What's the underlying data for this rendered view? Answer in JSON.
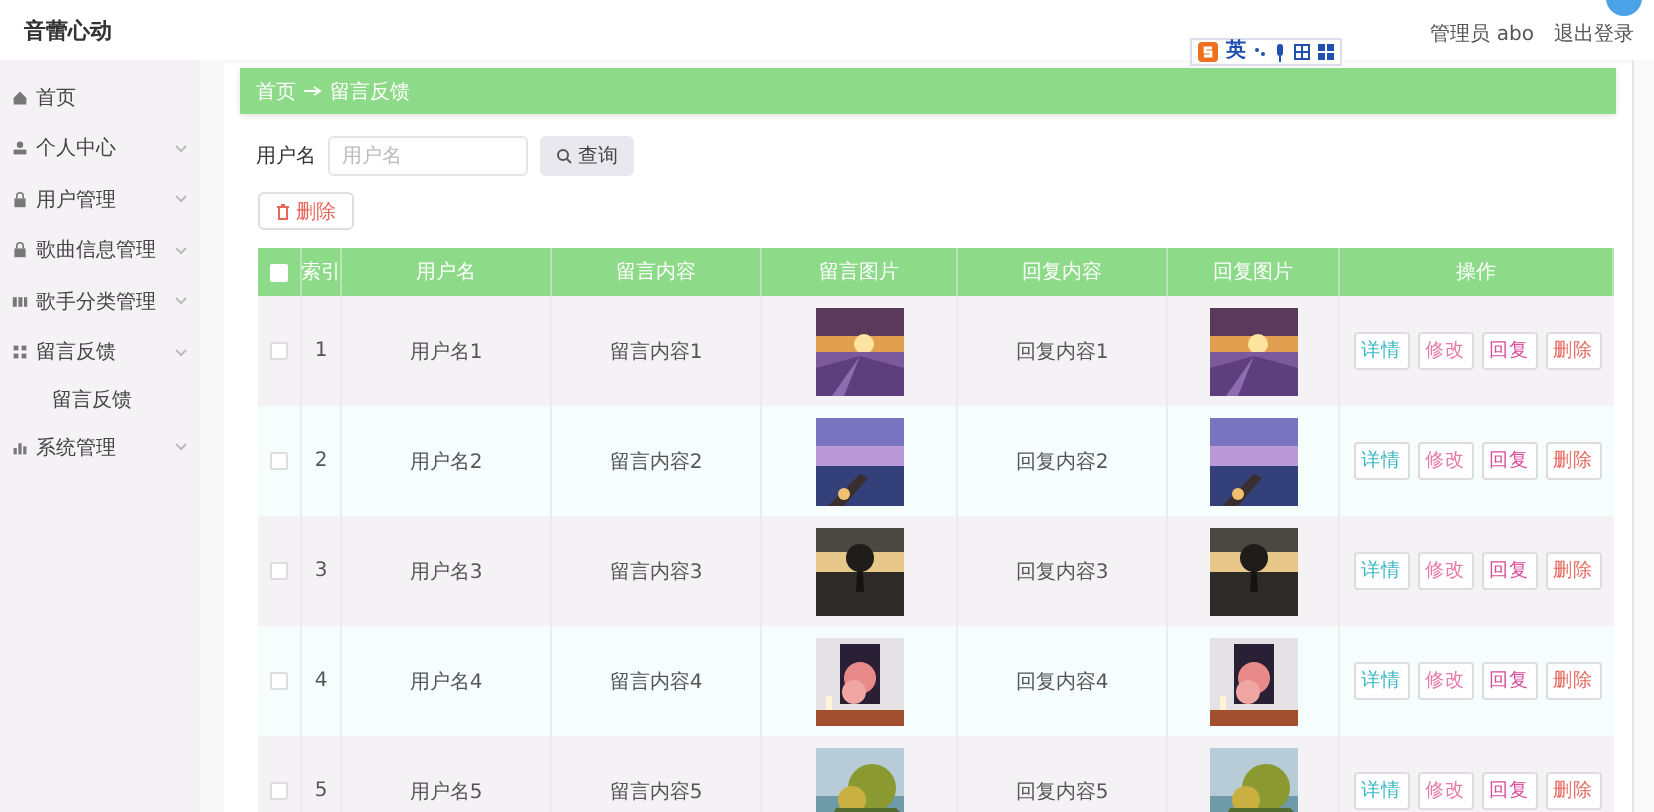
{
  "app": {
    "title": "音蕾心动",
    "user": "管理员 abo",
    "logout": "退出登录"
  },
  "ime_bar": {
    "mode": "英"
  },
  "sidebar": {
    "items": [
      {
        "label": "首页",
        "expandable": false
      },
      {
        "label": "个人中心",
        "expandable": true
      },
      {
        "label": "用户管理",
        "expandable": true
      },
      {
        "label": "歌曲信息管理",
        "expandable": true
      },
      {
        "label": "歌手分类管理",
        "expandable": true
      },
      {
        "label": "留言反馈",
        "expandable": true,
        "children": [
          {
            "label": "留言反馈"
          }
        ]
      },
      {
        "label": "系统管理",
        "expandable": true
      }
    ]
  },
  "breadcrumb": [
    "首页",
    "留言反馈"
  ],
  "search": {
    "label": "用户名",
    "placeholder": "用户名",
    "button": "查询"
  },
  "delete_button": "删除",
  "table": {
    "select_all": false,
    "columns": [
      "索引",
      "用户名",
      "留言内容",
      "留言图片",
      "回复内容",
      "回复图片",
      "操作"
    ],
    "rows": [
      {
        "selected": false,
        "index": "1",
        "username": "用户名1",
        "message": "留言内容1",
        "reply": "回复内容1",
        "actions": [
          {
            "label": "详情",
            "color": "#3bb7c4"
          },
          {
            "label": "修改",
            "color": "#e77aa8"
          },
          {
            "label": "回复",
            "color": "#d94c9a"
          },
          {
            "label": "删除",
            "color": "#e8675c"
          }
        ]
      },
      {
        "selected": false,
        "index": "2",
        "username": "用户名2",
        "message": "留言内容2",
        "reply": "回复内容2",
        "actions": [
          {
            "label": "详情",
            "color": "#3bb7c4"
          },
          {
            "label": "修改",
            "color": "#e77aa8"
          },
          {
            "label": "回复",
            "color": "#d94c9a"
          },
          {
            "label": "删除",
            "color": "#e8675c"
          }
        ]
      },
      {
        "selected": false,
        "index": "3",
        "username": "用户名3",
        "message": "留言内容3",
        "reply": "回复内容3",
        "actions": [
          {
            "label": "详情",
            "color": "#3bb7c4"
          },
          {
            "label": "修改",
            "color": "#e77aa8"
          },
          {
            "label": "回复",
            "color": "#d94c9a"
          },
          {
            "label": "删除",
            "color": "#e8675c"
          }
        ]
      },
      {
        "selected": false,
        "index": "4",
        "username": "用户名4",
        "message": "留言内容4",
        "reply": "回复内容4",
        "actions": [
          {
            "label": "详情",
            "color": "#3bb7c4"
          },
          {
            "label": "修改",
            "color": "#e77aa8"
          },
          {
            "label": "回复",
            "color": "#d94c9a"
          },
          {
            "label": "删除",
            "color": "#e8675c"
          }
        ]
      },
      {
        "selected": false,
        "index": "5",
        "username": "用户名5",
        "message": "留言内容5",
        "reply": "回复内容5",
        "actions": [
          {
            "label": "详情",
            "color": "#3bb7c4"
          },
          {
            "label": "修改",
            "color": "#e77aa8"
          },
          {
            "label": "回复",
            "color": "#d94c9a"
          },
          {
            "label": "删除",
            "color": "#e8675c"
          }
        ]
      }
    ]
  }
}
